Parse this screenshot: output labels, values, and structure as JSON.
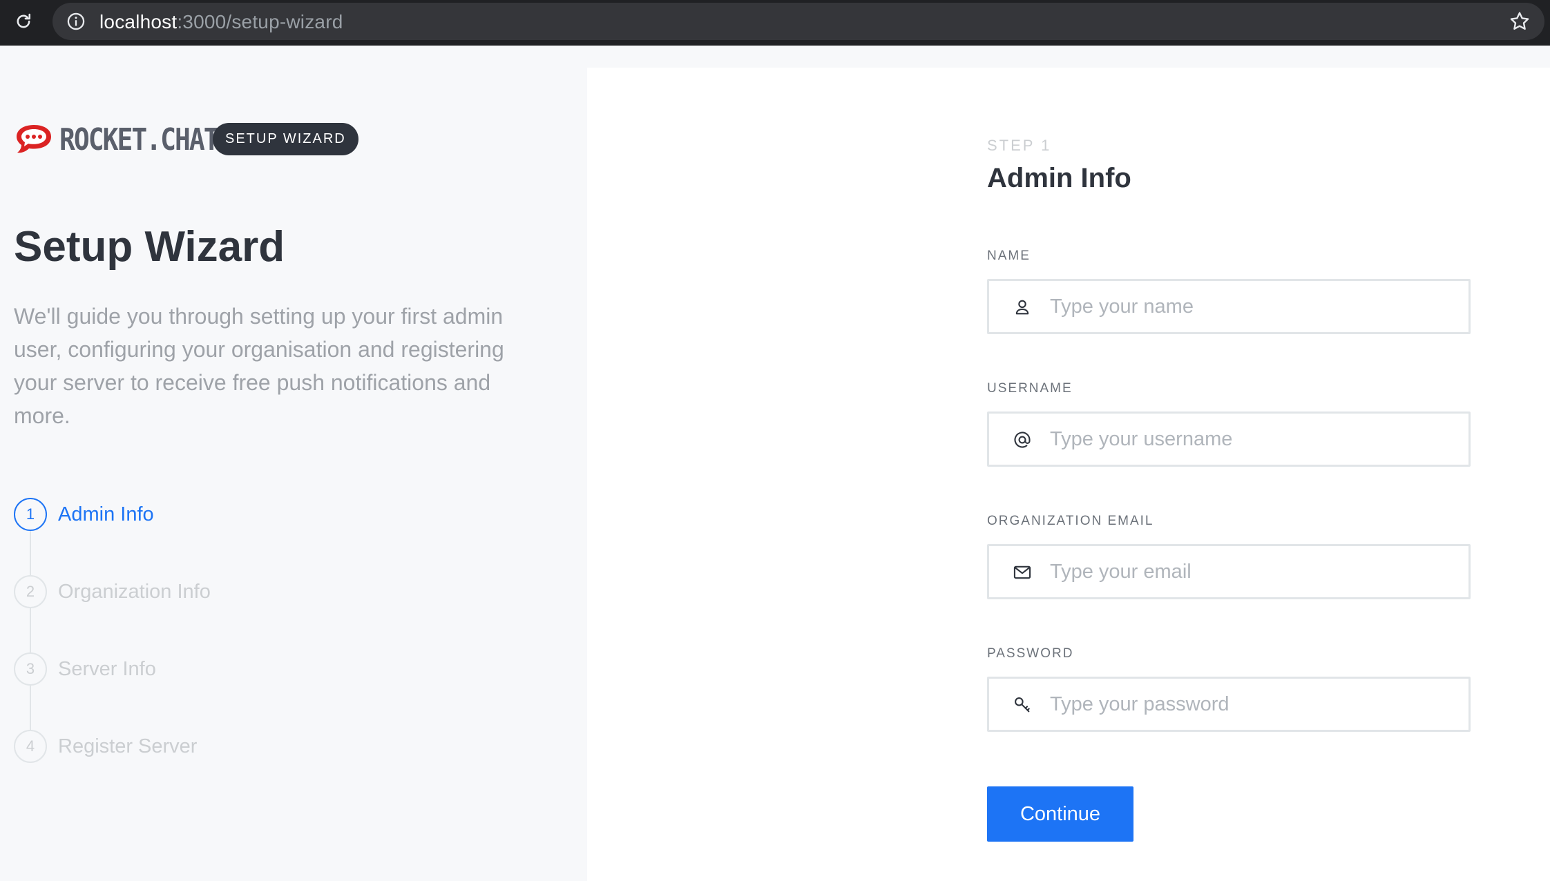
{
  "browser": {
    "url_host": "localhost",
    "url_path": ":3000/setup-wizard"
  },
  "sidebar": {
    "brand_text": "ROCKET.CHAT",
    "badge": "SETUP WIZARD",
    "title": "Setup Wizard",
    "description": "We'll guide you through setting up your first admin user, configuring your organisation and registering your server to receive free push notifications and more.",
    "steps": [
      {
        "number": "1",
        "label": "Admin Info",
        "active": true
      },
      {
        "number": "2",
        "label": "Organization Info",
        "active": false
      },
      {
        "number": "3",
        "label": "Server Info",
        "active": false
      },
      {
        "number": "4",
        "label": "Register Server",
        "active": false
      }
    ]
  },
  "form": {
    "step_number": "STEP 1",
    "title": "Admin Info",
    "fields": [
      {
        "label": "NAME",
        "icon": "user-icon",
        "placeholder": "Type your name",
        "value": ""
      },
      {
        "label": "USERNAME",
        "icon": "at-icon",
        "placeholder": "Type your username",
        "value": ""
      },
      {
        "label": "ORGANIZATION EMAIL",
        "icon": "mail-icon",
        "placeholder": "Type your email",
        "value": ""
      },
      {
        "label": "PASSWORD",
        "icon": "key-icon",
        "placeholder": "Type your password",
        "value": ""
      }
    ],
    "continue_label": "Continue"
  },
  "colors": {
    "accent": "#1d74f5",
    "dark": "#2f343d",
    "logo_red": "#db2323"
  }
}
